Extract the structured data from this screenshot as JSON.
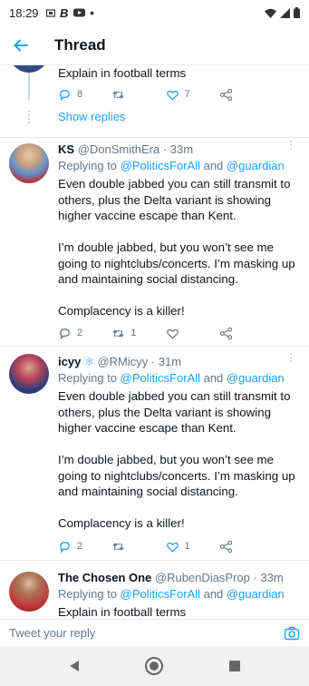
{
  "status_bar": {
    "time": "18:29"
  },
  "app_bar": {
    "title": "Thread"
  },
  "top_tweet": {
    "text": "Explain in football terms",
    "reply_count": "8",
    "like_count": "7",
    "show_replies": "Show replies"
  },
  "tweets": [
    {
      "name": "KS",
      "handle": "@DonSmithEra · 33m",
      "replying_prefix": "Replying to ",
      "replying_to_1": "@PoliticsForAll",
      "replying_and": " and ",
      "replying_to_2": "@guardian",
      "text": "Even double jabbed you can still transmit to others, plus the Delta variant is showing higher vaccine escape than Kent.\n\nI’m double jabbed, but you won’t see me going to nightclubs/concerts. I’m masking up and maintaining social distancing.\n\nComplacency is a killer!",
      "reply_count": "2",
      "retweet_count": "1",
      "like_count": ""
    },
    {
      "name": "icyy",
      "handle": "@RMicyy · 31m",
      "replying_prefix": "Replying to ",
      "replying_to_1": "@PoliticsForAll",
      "replying_and": " and ",
      "replying_to_2": "@guardian",
      "text": "Even double jabbed you can still transmit to others, plus the Delta variant is showing higher vaccine escape than Kent.\n\nI’m double jabbed, but you won’t see me going to nightclubs/concerts. I’m masking up and maintaining social distancing.\n\nComplacency is a killer!",
      "reply_count": "2",
      "retweet_count": "",
      "like_count": "1"
    },
    {
      "name": "The Chosen One",
      "handle": "@RubenDiasProp · 33m",
      "replying_prefix": "Replying to ",
      "replying_to_1": "@PoliticsForAll",
      "replying_and": " and ",
      "replying_to_2": "@guardian",
      "text": "Explain in football terms"
    }
  ],
  "compose": {
    "placeholder": "Tweet your reply"
  },
  "colors": {
    "accent": "#1da1f2",
    "secondary_text": "#657786",
    "divider": "#e6ecf0"
  }
}
